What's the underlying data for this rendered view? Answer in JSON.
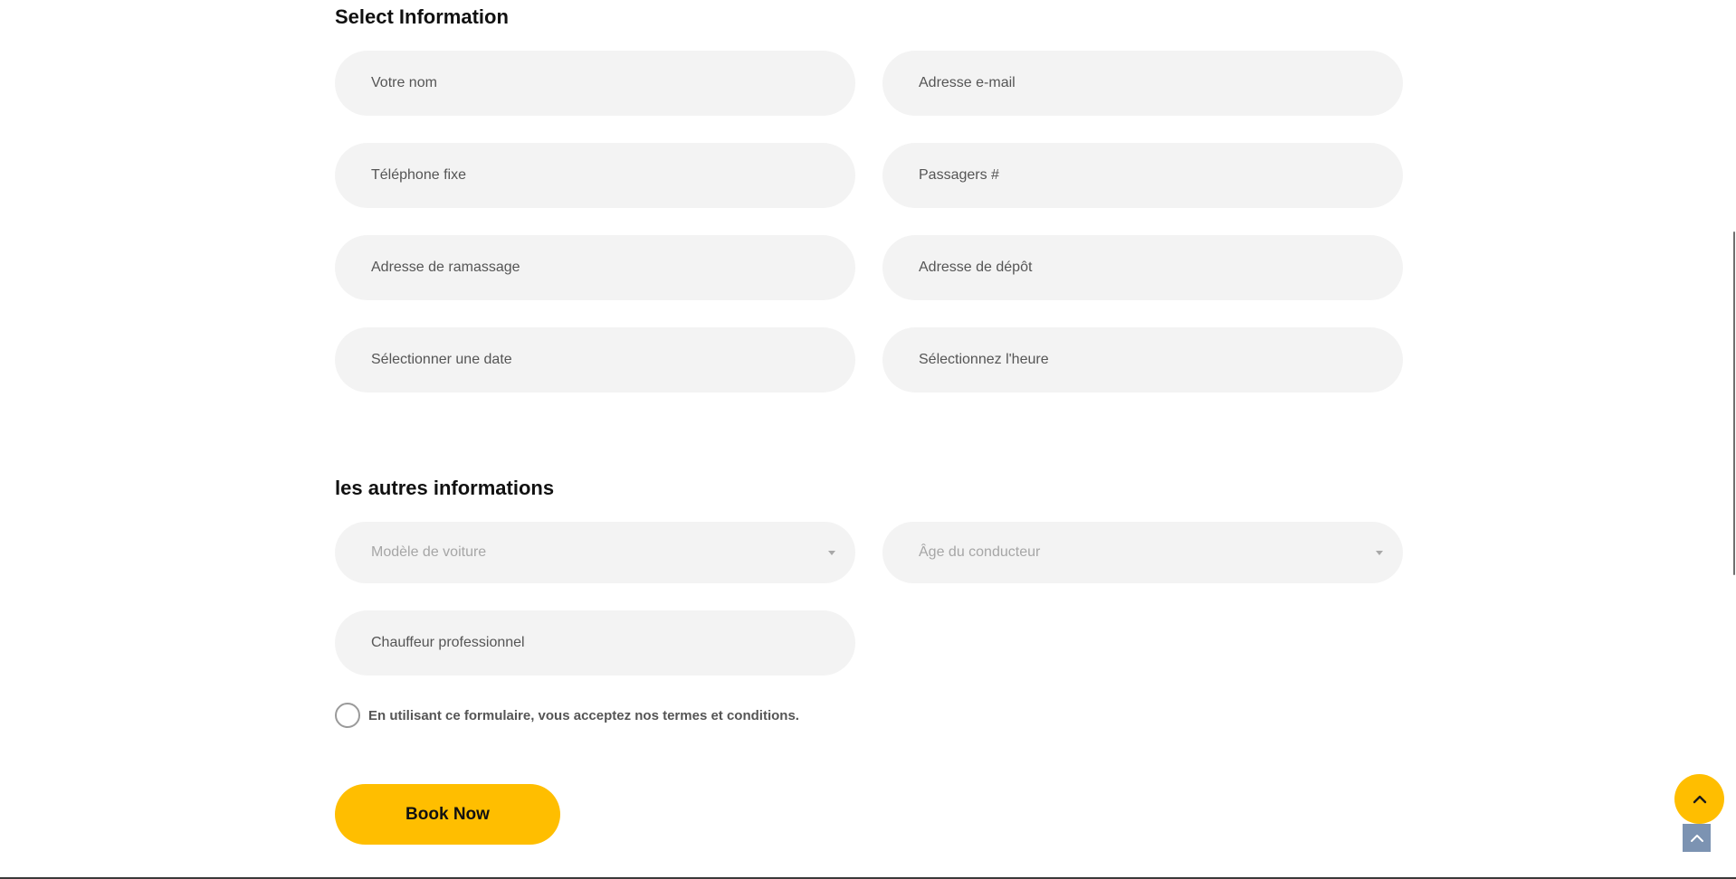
{
  "sections": {
    "select_info_title": "Select Information",
    "other_info_title": "les autres informations"
  },
  "fields": {
    "name": {
      "placeholder": "Votre nom"
    },
    "email": {
      "placeholder": "Adresse e-mail"
    },
    "phone": {
      "placeholder": "Téléphone fixe"
    },
    "passengers": {
      "placeholder": "Passagers #"
    },
    "pickup": {
      "placeholder": "Adresse de ramassage"
    },
    "dropoff": {
      "placeholder": "Adresse de dépôt"
    },
    "date": {
      "placeholder": "Sélectionner une date"
    },
    "time": {
      "placeholder": "Sélectionnez l'heure"
    },
    "car_model": {
      "selected": "Modèle de voiture"
    },
    "driver_age": {
      "selected": "Âge du conducteur"
    },
    "chauffeur": {
      "placeholder": "Chauffeur professionnel"
    }
  },
  "terms": {
    "label": "En utilisant ce formulaire, vous acceptez nos termes et conditions."
  },
  "actions": {
    "book_label": "Book Now"
  },
  "icons": {
    "scroll_top": "chevron-up-icon",
    "back_to_top": "chevron-up-icon"
  },
  "colors": {
    "accent": "#ffbe00",
    "field_bg": "#f3f3f3",
    "back_to_top_bg": "#7c93b2"
  }
}
